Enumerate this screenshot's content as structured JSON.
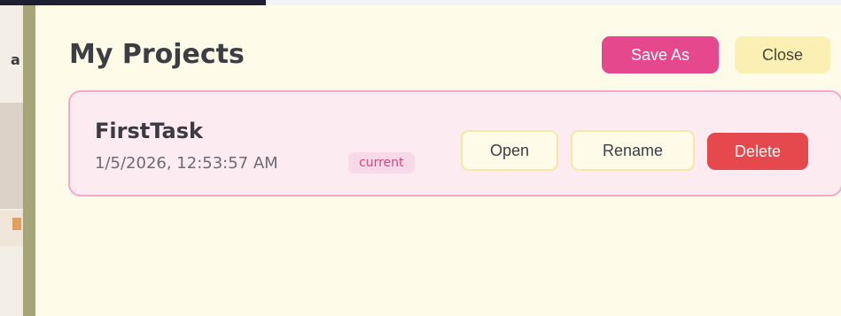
{
  "dialog": {
    "title": "My Projects",
    "save_as_label": "Save As",
    "close_label": "Close"
  },
  "projects": [
    {
      "name": "FirstTask",
      "date": "1/5/2026, 12:53:57 AM",
      "badge": "current",
      "open_label": "Open",
      "rename_label": "Rename",
      "delete_label": "Delete"
    }
  ],
  "background_app": {
    "partial_letter": "a"
  },
  "colors": {
    "panel_bg": "#fefbe9",
    "accent_pink": "#e6488e",
    "close_bg": "#fbefb4",
    "card_border": "#f4a8cc",
    "card_bg": "#fcebf1",
    "danger": "#e5484d"
  }
}
